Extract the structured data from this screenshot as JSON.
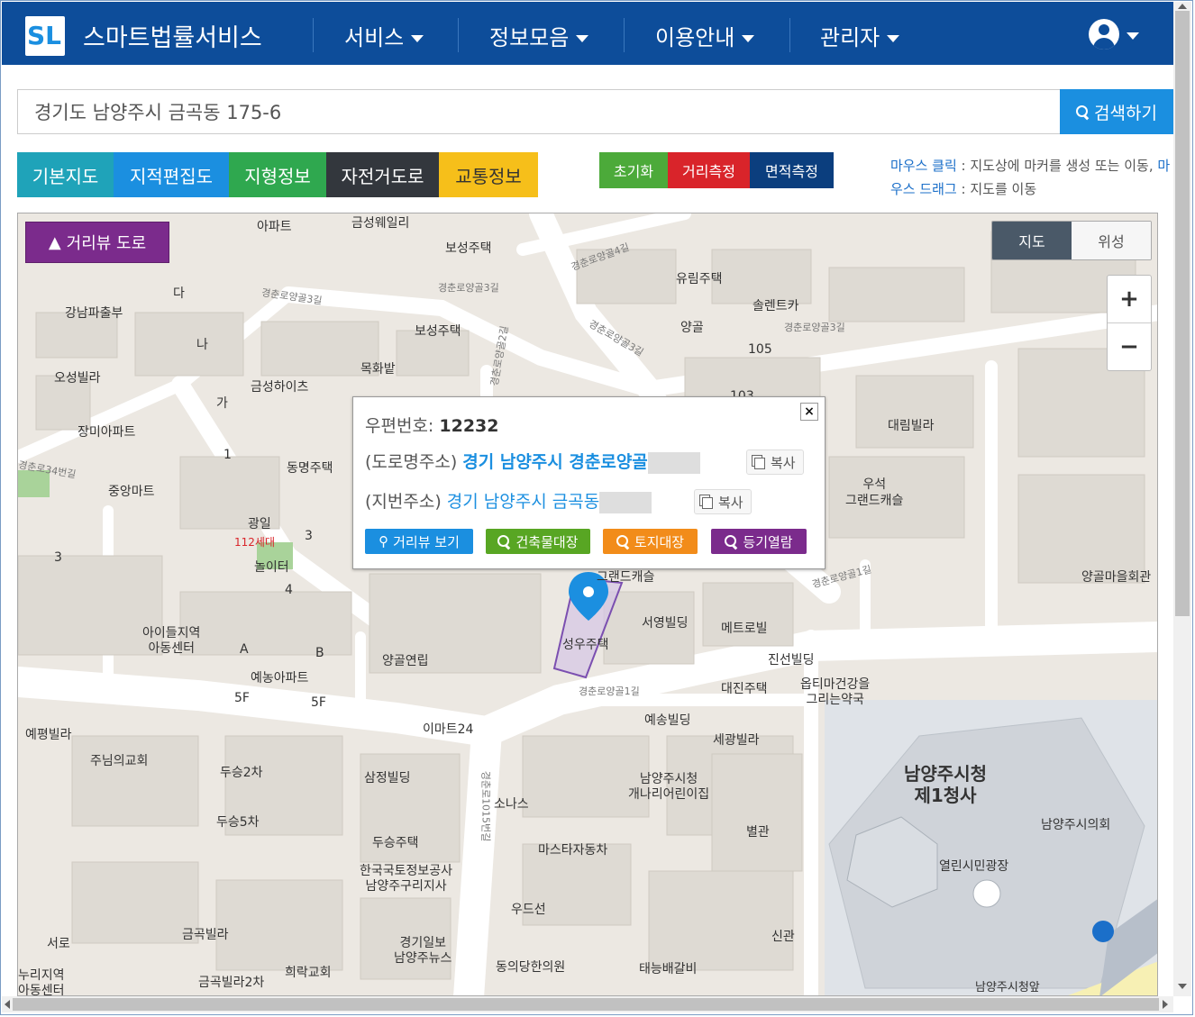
{
  "app": {
    "brand": "스마트법률서비스",
    "logo": "SL",
    "nav": [
      {
        "label": "서비스"
      },
      {
        "label": "정보모음"
      },
      {
        "label": "이용안내"
      },
      {
        "label": "관리자"
      }
    ],
    "user_icon": "user-circle-icon"
  },
  "search": {
    "value": "경기도 남양주시 금곡동 175-6",
    "button": "검색하기"
  },
  "map_tabs": [
    {
      "label": "기본지도",
      "color": "#1fa3b9"
    },
    {
      "label": "지적편집도",
      "color": "#1b8fe0"
    },
    {
      "label": "지형정보",
      "color": "#2fa84f"
    },
    {
      "label": "자전거도로",
      "color": "#33373d"
    },
    {
      "label": "교통정보",
      "color": "#f6bf1a"
    }
  ],
  "tools": [
    {
      "label": "초기화",
      "color": "#4caa3a"
    },
    {
      "label": "거리측정",
      "color": "#d9242a"
    },
    {
      "label": "면적측정",
      "color": "#0b3e7e"
    }
  ],
  "help": {
    "click_key": "마우스 클릭",
    "click_text": " : 지도상에 마커를 생성 또는 이동, ",
    "drag_key": "마우스 드래그",
    "drag_text": " : 지도를 이동"
  },
  "map": {
    "streetview_label": "거리뷰 도로",
    "type_map": "지도",
    "type_satellite": "위성",
    "zoom_in": "+",
    "zoom_out": "−",
    "labels": {
      "apt_top": "아파트",
      "geumsung_apt": "금성웨일리",
      "boseong1": "보성주택",
      "boseong2": "보성주택",
      "yurim": "유림주택",
      "solrent": "솔렌트카",
      "yanggol": "양골",
      "gangnam": "강남파출부",
      "oseong": "오성빌라",
      "geumsung_heights": "금성하이츠",
      "mokhwa": "목화밭",
      "jangmi": "장미아파트",
      "dongmyeong": "동명주택",
      "jungang": "중앙마트",
      "gwangil": "광일",
      "playground": "놀이터",
      "children": "아이들지역\n아동센터",
      "yegnong": "예농아파트",
      "yanggol_yeonrip": "양골연립",
      "daerim": "대림빌라",
      "useok": "우석\n그랜드캐슬",
      "yanggol_hall": "양골마을회관",
      "grandcastle": "그랜드캐슬",
      "seoyoung": "서영빌딩",
      "metro": "메트로빌",
      "seongwoo": "성우주택",
      "jinsun": "진선빌딩",
      "daejin": "대진주택",
      "optima": "옵티마건강을\n그리는약국",
      "yesong": "예송빌딩",
      "segwang": "세광빌라",
      "emart": "이마트24",
      "yepyeong": "예평빌라",
      "jusarang": "주님의교회",
      "duseung2": "두승2차",
      "samjeong": "삼정빌딩",
      "sonas": "소나스",
      "nyj_daycare": "남양주시청\n개나리어린이집",
      "nyj_hall": "남양주시청\n제1청사",
      "annex": "별관",
      "nyj_council": "남양주시의회",
      "duseung5": "두승5차",
      "duseung_house": "두승주택",
      "masta": "마스타자동차",
      "lh": "한국국토정보공사\n남양주구리지사",
      "plaza": "열린시민광장",
      "woodsun": "우드선",
      "geumgok": "금곡빌라",
      "seoro": "서로",
      "gyeonggi": "경기일보\n남양주뉴스",
      "dongui": "동의당한의원",
      "taeneung": "태능배갈비",
      "newbuilding": "신관",
      "nuri": "누리지역\n아동센터",
      "geumgok2": "금곡빌라2차",
      "huirak": "희락교회",
      "nyj_front": "남양주시청앞",
      "ga": "가",
      "na": "나",
      "da": "다",
      "n105": "105",
      "n103": "103",
      "n1": "1",
      "n3a": "3",
      "n3b": "3",
      "n4": "4",
      "n5f1": "5F",
      "n5f2": "5F",
      "a": "A",
      "b": "B",
      "s112": "112세대",
      "road1": "경춘로양골3길",
      "road2": "경춘로양골3길",
      "road3": "경춘로양골2길",
      "road4": "경춘로양골4길",
      "road5": "경춘로양골1길",
      "road6": "경춘로1015번길",
      "road7": "경춘로34번길",
      "road8": "경춘로양골3길",
      "road9": "경춘로양골1길",
      "road10": "경춘로양골3길"
    }
  },
  "popup": {
    "postal_label": "우편번호: ",
    "postal_code": "12232",
    "road_label": "(도로명주소) ",
    "road_value": "경기 남양주시 경춘로양골",
    "jibun_label": "(지번주소) ",
    "jibun_value": "경기 남양주시 금곡동",
    "copy": "복사",
    "buttons": [
      {
        "label": "거리뷰 보기",
        "color": "#1b8fe0"
      },
      {
        "label": "건축물대장",
        "color": "#58a623"
      },
      {
        "label": "토지대장",
        "color": "#f28c1a"
      },
      {
        "label": "등기열람",
        "color": "#7b2b8c"
      }
    ]
  }
}
